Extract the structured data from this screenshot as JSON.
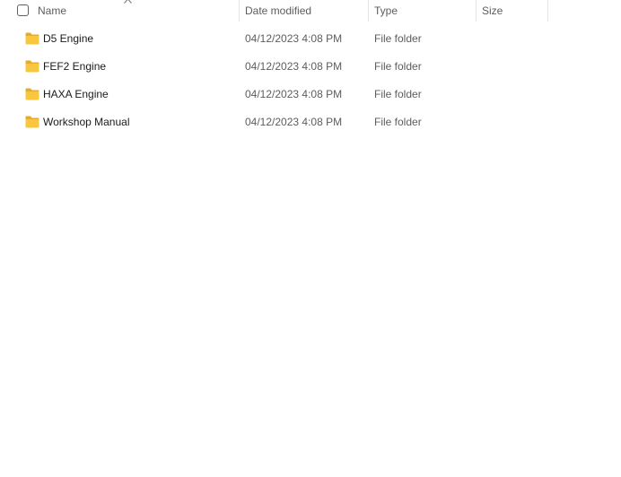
{
  "header": {
    "columns": {
      "name": "Name",
      "date": "Date modified",
      "type": "Type",
      "size": "Size"
    },
    "sort_icon": "chevron-up-icon"
  },
  "rows": [
    {
      "name": "D5 Engine",
      "date": "04/12/2023 4:08 PM",
      "type": "File folder",
      "size": ""
    },
    {
      "name": "FEF2 Engine",
      "date": "04/12/2023 4:08 PM",
      "type": "File folder",
      "size": ""
    },
    {
      "name": "HAXA Engine",
      "date": "04/12/2023 4:08 PM",
      "type": "File folder",
      "size": ""
    },
    {
      "name": "Workshop Manual",
      "date": "04/12/2023 4:08 PM",
      "type": "File folder",
      "size": ""
    }
  ],
  "colors": {
    "folder_fill": "#F8C73E",
    "folder_tab": "#E9A92A",
    "header_text": "#5D5D5D"
  }
}
